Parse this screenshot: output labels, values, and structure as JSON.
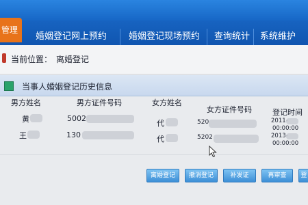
{
  "nav": {
    "active_tab": "管理",
    "tabs": [
      {
        "label": "婚姻登记网上预约"
      },
      {
        "label": "婚姻登记现场预约"
      },
      {
        "label": "查询统计"
      },
      {
        "label": "系统维护"
      }
    ]
  },
  "breadcrumb": {
    "label": "当前位置：",
    "value": "离婚登记"
  },
  "panel": {
    "title": "当事人婚姻登记历史信息"
  },
  "table": {
    "headers": [
      "男方姓名",
      "男方证件号码",
      "女方姓名",
      "女方证件号码",
      "登记时间"
    ],
    "rows": [
      {
        "male_name": "黄",
        "male_id": "5002",
        "female_name": "代",
        "female_id": "520",
        "date": "2011-",
        "time": "00:00:00"
      },
      {
        "male_name": "王",
        "male_id": "130",
        "female_name": "代",
        "female_id": "5202",
        "date": "2013-",
        "time": "00:00:00"
      }
    ]
  },
  "buttons": [
    {
      "label": "离婚登记"
    },
    {
      "label": "撤消登记"
    },
    {
      "label": "补发证"
    },
    {
      "label": "再审查"
    },
    {
      "label": "登"
    }
  ],
  "colors": {
    "nav_blue": "#1561c0",
    "active_orange": "#e8731a",
    "button_blue": "#4b9de0"
  }
}
